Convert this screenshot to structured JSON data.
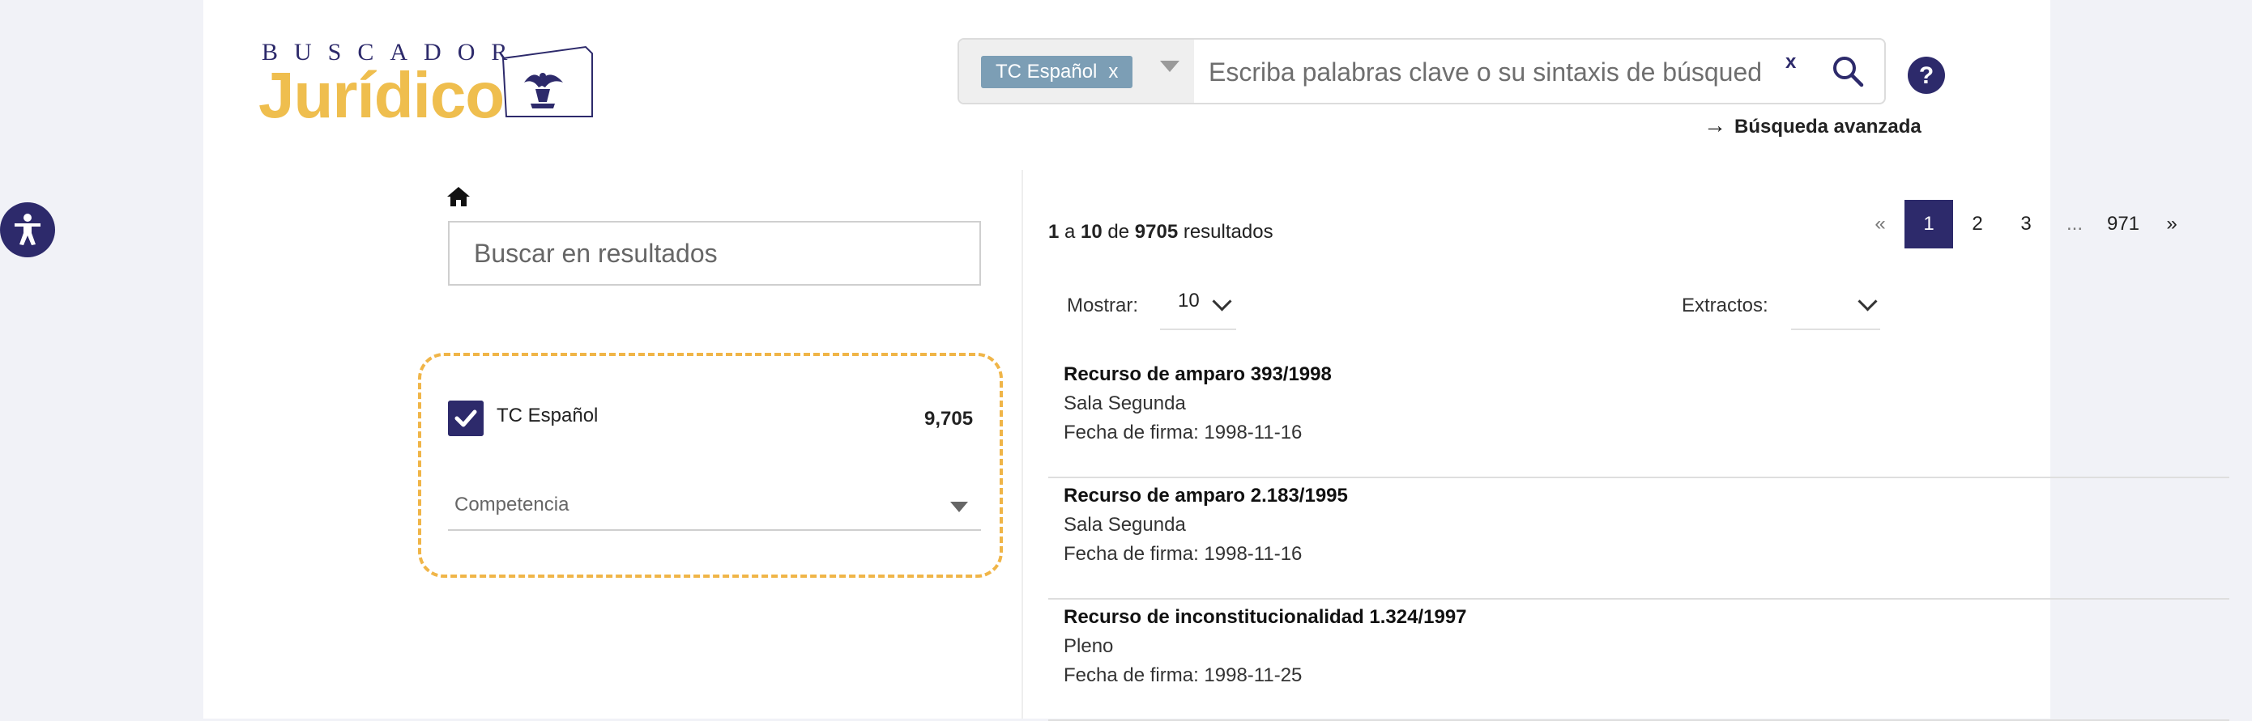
{
  "logo": {
    "top_text": "BUSCADOR",
    "main_text": "Jurídico"
  },
  "search": {
    "filter_tag": "TC Español",
    "filter_tag_remove": "x",
    "placeholder": "Escriba palabras clave o su sintaxis de búsqued",
    "clear": "x",
    "advanced_arrow": "→",
    "advanced_label": "Búsqueda avanzada"
  },
  "sidebar": {
    "results_search_placeholder": "Buscar en resultados",
    "facet": {
      "label": "TC Español",
      "count": "9,705",
      "checked": true
    },
    "competencia_label": "Competencia"
  },
  "results": {
    "count_from": "1",
    "count_sep1": " a ",
    "count_to": "10",
    "count_sep2": " de ",
    "count_total": "9705",
    "count_suffix": " resultados",
    "mostrar_label": "Mostrar:",
    "mostrar_value": "10",
    "extractos_label": "Extractos:",
    "pagination": [
      "«",
      "1",
      "2",
      "3",
      "...",
      "971",
      "»"
    ],
    "items": [
      {
        "title": "Recurso de amparo 393/1998",
        "sala": "Sala Segunda",
        "fecha": "Fecha de firma: 1998-11-16"
      },
      {
        "title": "Recurso de amparo 2.183/1995",
        "sala": "Sala Segunda",
        "fecha": "Fecha de firma: 1998-11-16"
      },
      {
        "title": "Recurso de inconstitucionalidad 1.324/1997",
        "sala": "Pleno",
        "fecha": "Fecha de firma: 1998-11-25"
      }
    ]
  },
  "colors": {
    "brand_navy": "#2d2a6b",
    "brand_gold": "#efbe4e",
    "tag_blue": "#7c9eb5",
    "highlight_dash": "#f0b548"
  },
  "icons": [
    "accessibility-icon",
    "home-icon",
    "search-icon",
    "help-icon",
    "chevron-down-icon",
    "checkmark-icon",
    "emblem-icon"
  ]
}
